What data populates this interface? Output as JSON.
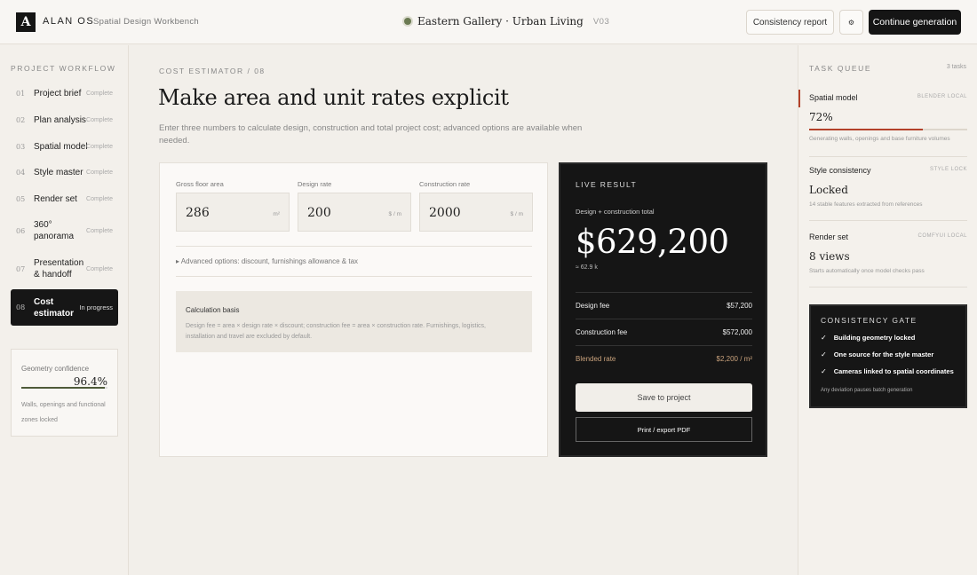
{
  "header": {
    "logo_letter": "A",
    "app_name": "ALAN OS",
    "app_subtitle": "Spatial Design Workbench",
    "project_name": "Eastern Gallery · Urban Living",
    "project_version": "V03",
    "consistency_report_label": "Consistency report",
    "gear_icon": "⚙",
    "continue_label": "Continue generation"
  },
  "sidebar": {
    "title": "PROJECT WORKFLOW",
    "items": [
      {
        "num": "01",
        "label": "Project brief",
        "status": "Complete"
      },
      {
        "num": "02",
        "label": "Plan analysis",
        "status": "Complete"
      },
      {
        "num": "03",
        "label": "Spatial model",
        "status": "Complete"
      },
      {
        "num": "04",
        "label": "Style master",
        "status": "Complete"
      },
      {
        "num": "05",
        "label": "Render set",
        "status": "Complete"
      },
      {
        "num": "06",
        "label": "360° panorama",
        "status": "Complete"
      },
      {
        "num": "07",
        "label": "Presentation & handoff",
        "status": "Complete"
      },
      {
        "num": "08",
        "label": "Cost estimator",
        "status": "In progress"
      }
    ],
    "confidence": {
      "label": "Geometry confidence",
      "value": "96.4%",
      "fraction": 0.964,
      "note": "Walls, openings and functional zones locked"
    }
  },
  "main": {
    "eyebrow": "COST ESTIMATOR / 08",
    "title": "Make area and unit rates explicit",
    "description": "Enter three numbers to calculate design, construction and total project cost; advanced options are available when needed.",
    "fields": [
      {
        "label": "Gross floor area",
        "value": "286",
        "unit": "m²"
      },
      {
        "label": "Design rate",
        "value": "200",
        "unit": "$ / m"
      },
      {
        "label": "Construction rate",
        "value": "2000",
        "unit": "$ / m"
      }
    ],
    "advanced_toggle": "▸ Advanced options: discount, furnishings allowance & tax",
    "basis_title": "Calculation basis",
    "basis_text": "Design fee = area × design rate × discount; construction fee = area × construction rate. Furnishings, logistics, installation and travel are excluded by default."
  },
  "result": {
    "title": "LIVE RESULT",
    "subtitle": "Design + construction total",
    "total": "$629,200",
    "approx": "≈ 62.9 k",
    "rows": [
      {
        "label": "Design fee",
        "value": "$57,200"
      },
      {
        "label": "Construction fee",
        "value": "$572,000"
      },
      {
        "label": "Blended rate",
        "value": "$2,200 / m²"
      }
    ],
    "save_label": "Save to project",
    "print_label": "Print / export PDF"
  },
  "tasks": {
    "title": "TASK QUEUE",
    "count": "3 tasks",
    "items": [
      {
        "name": "Spatial model",
        "tag": "BLENDER LOCAL",
        "value": "72%",
        "progress": 0.72,
        "note": "Generating walls, openings and base furniture volumes"
      },
      {
        "name": "Style consistency",
        "tag": "STYLE LOCK",
        "value": "Locked",
        "note": "14 stable features extracted from references"
      },
      {
        "name": "Render set",
        "tag": "COMFYUI LOCAL",
        "value": "8 views",
        "note": "Starts automatically once model checks pass"
      }
    ]
  },
  "gate": {
    "title": "CONSISTENCY GATE",
    "items": [
      "Building geometry locked",
      "One source for the style master",
      "Cameras linked to spatial coordinates"
    ],
    "note": "Any deviation pauses batch generation"
  },
  "colors": {
    "accent_red": "#b3412a",
    "dark": "#151515",
    "olive": "#4e5a3a",
    "bronze": "#c9a27c"
  }
}
